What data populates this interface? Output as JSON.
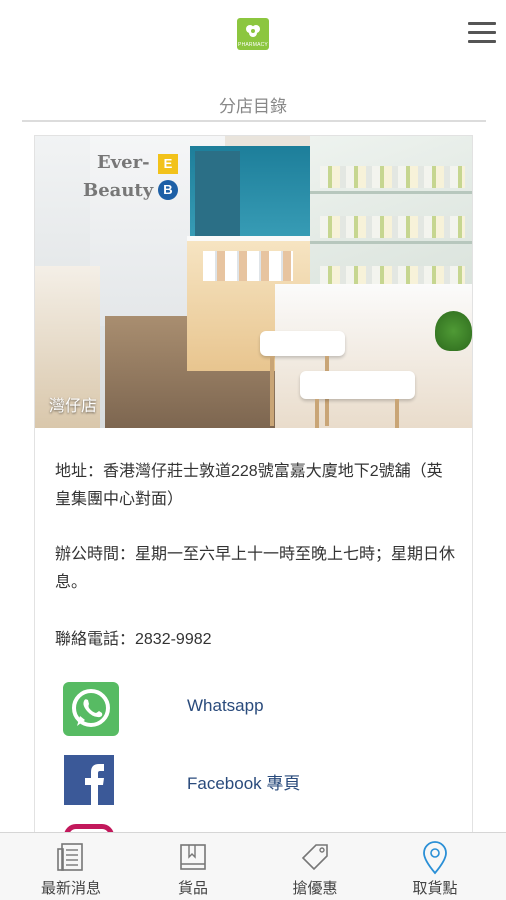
{
  "header": {
    "logo_tag": "PHARMACY",
    "menu_icon": "hamburger-menu-icon"
  },
  "section": {
    "title": "分店目錄"
  },
  "store": {
    "photo_caption": "灣仔店",
    "sign_line1": "Ever-",
    "sign_line2": "Beauty",
    "sign_badge_e": "E",
    "sign_badge_b": "B",
    "address": "地址：香港灣仔莊士敦道228號富嘉大廈地下2號舖（英皇集團中心對面）",
    "hours": "辦公時間：星期一至六早上十一時至晚上七時；星期日休息。",
    "phone": "聯絡電話：2832-9982"
  },
  "social": {
    "whatsapp_label": "Whatsapp",
    "facebook_label": "Facebook 專頁"
  },
  "bottom_nav": {
    "items": [
      {
        "label": "最新消息",
        "icon": "newspaper-icon"
      },
      {
        "label": "貨品",
        "icon": "book-icon"
      },
      {
        "label": "搶優惠",
        "icon": "price-tag-icon"
      },
      {
        "label": "取貨點",
        "icon": "location-pin-icon"
      }
    ]
  },
  "colors": {
    "brand_green": "#8cc63f",
    "link_blue": "#2a4b7c",
    "active_blue": "#2a8fd6"
  }
}
